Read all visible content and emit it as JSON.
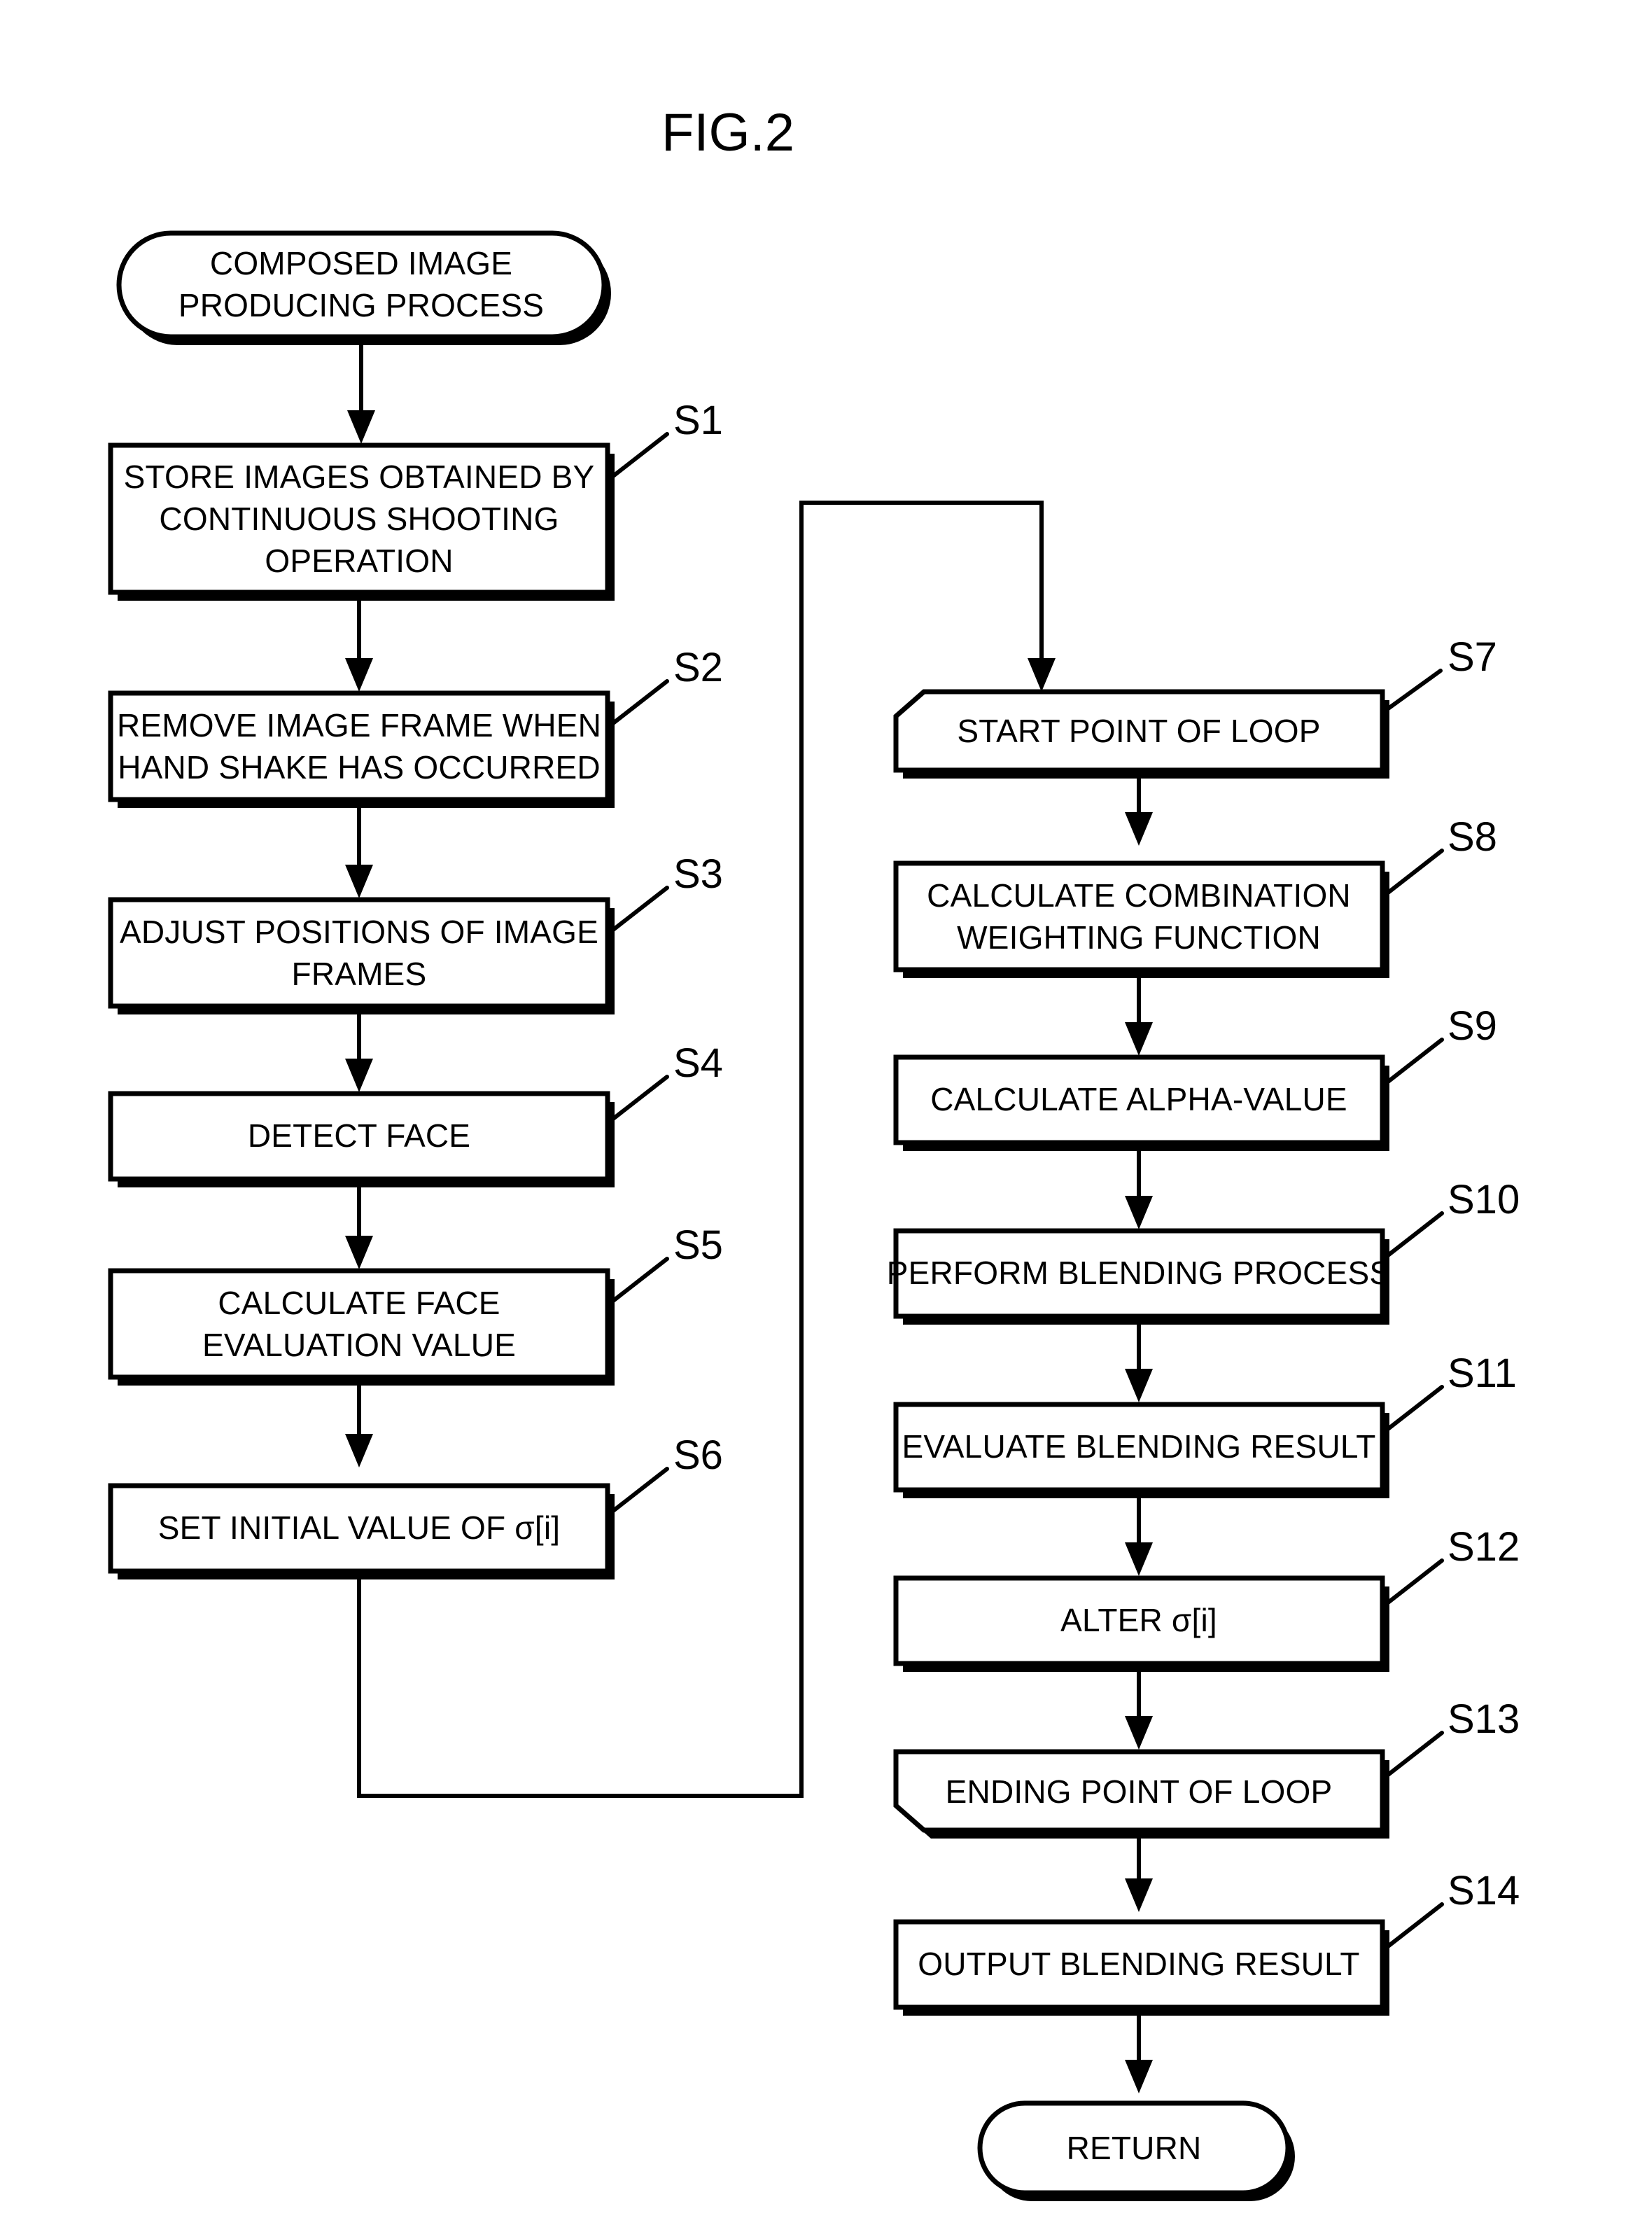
{
  "figure": {
    "title": "FIG.2",
    "type": "patent-flowchart"
  },
  "nodes": {
    "start": {
      "label_line1": "COMPOSED IMAGE",
      "label_line2": "PRODUCING PROCESS",
      "shape": "terminator"
    },
    "s1": {
      "step": "S1",
      "label_line1": "STORE IMAGES OBTAINED BY",
      "label_line2": "CONTINUOUS SHOOTING",
      "label_line3": "OPERATION",
      "shape": "process"
    },
    "s2": {
      "step": "S2",
      "label_line1": "REMOVE IMAGE FRAME WHEN",
      "label_line2": "HAND SHAKE HAS OCCURRED",
      "shape": "process"
    },
    "s3": {
      "step": "S3",
      "label_line1": "ADJUST POSITIONS OF IMAGE",
      "label_line2": "FRAMES",
      "shape": "process"
    },
    "s4": {
      "step": "S4",
      "label_line1": "DETECT FACE",
      "shape": "process"
    },
    "s5": {
      "step": "S5",
      "label_line1": "CALCULATE FACE",
      "label_line2": "EVALUATION VALUE",
      "shape": "process"
    },
    "s6": {
      "step": "S6",
      "label_line1": "SET INITIAL VALUE OF σ[i]",
      "shape": "process"
    },
    "s7": {
      "step": "S7",
      "label_line1": "START POINT OF LOOP",
      "shape": "loop-start"
    },
    "s8": {
      "step": "S8",
      "label_line1": "CALCULATE COMBINATION",
      "label_line2": "WEIGHTING FUNCTION",
      "shape": "process"
    },
    "s9": {
      "step": "S9",
      "label_line1": "CALCULATE ALPHA-VALUE",
      "shape": "process"
    },
    "s10": {
      "step": "S10",
      "label_line1": "PERFORM BLENDING PROCESS",
      "shape": "process"
    },
    "s11": {
      "step": "S11",
      "label_line1": "EVALUATE BLENDING RESULT",
      "shape": "process"
    },
    "s12": {
      "step": "S12",
      "label_line1": "ALTER σ[i]",
      "shape": "process"
    },
    "s13": {
      "step": "S13",
      "label_line1": "ENDING POINT OF LOOP",
      "shape": "loop-end"
    },
    "s14": {
      "step": "S14",
      "label_line1": "OUTPUT BLENDING RESULT",
      "shape": "process"
    },
    "end": {
      "label_line1": "RETURN",
      "shape": "terminator"
    }
  },
  "colors": {
    "stroke": "#000000",
    "fill": "#ffffff",
    "background": "#ffffff"
  }
}
